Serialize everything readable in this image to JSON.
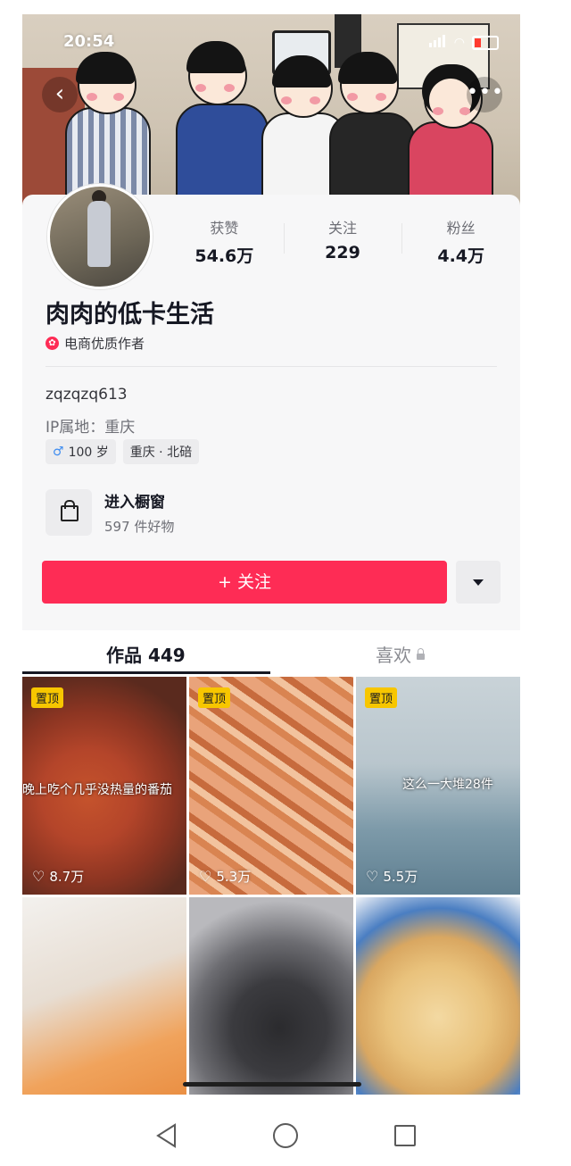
{
  "status_bar": {
    "time": "20:54"
  },
  "profile": {
    "stats": [
      {
        "label": "获赞",
        "value": "54.6万"
      },
      {
        "label": "关注",
        "value": "229"
      },
      {
        "label": "粉丝",
        "value": "4.4万"
      }
    ],
    "nickname": "肉肉的低卡生活",
    "certification": "电商优质作者",
    "user_id": "zqzqzq613",
    "ip_location": "IP属地：重庆",
    "tags": {
      "gender_symbol": "♂",
      "age": "100 岁",
      "location": "重庆 · 北碚"
    },
    "shop": {
      "title": "进入橱窗",
      "subtitle": "597 件好物"
    },
    "follow_label": "+ 关注"
  },
  "tabs": {
    "works": "作品 449",
    "likes": "喜欢"
  },
  "videos": [
    {
      "pinned": "置顶",
      "likes": "8.7万",
      "overlay": "晚上吃个几乎没热量的番茄"
    },
    {
      "pinned": "置顶",
      "likes": "5.3万"
    },
    {
      "pinned": "置顶",
      "likes": "5.5万",
      "overlay": "这么一大堆28件"
    },
    {},
    {},
    {}
  ],
  "colors": {
    "accent": "#fe2c55",
    "pin_badge": "#f7c600"
  }
}
